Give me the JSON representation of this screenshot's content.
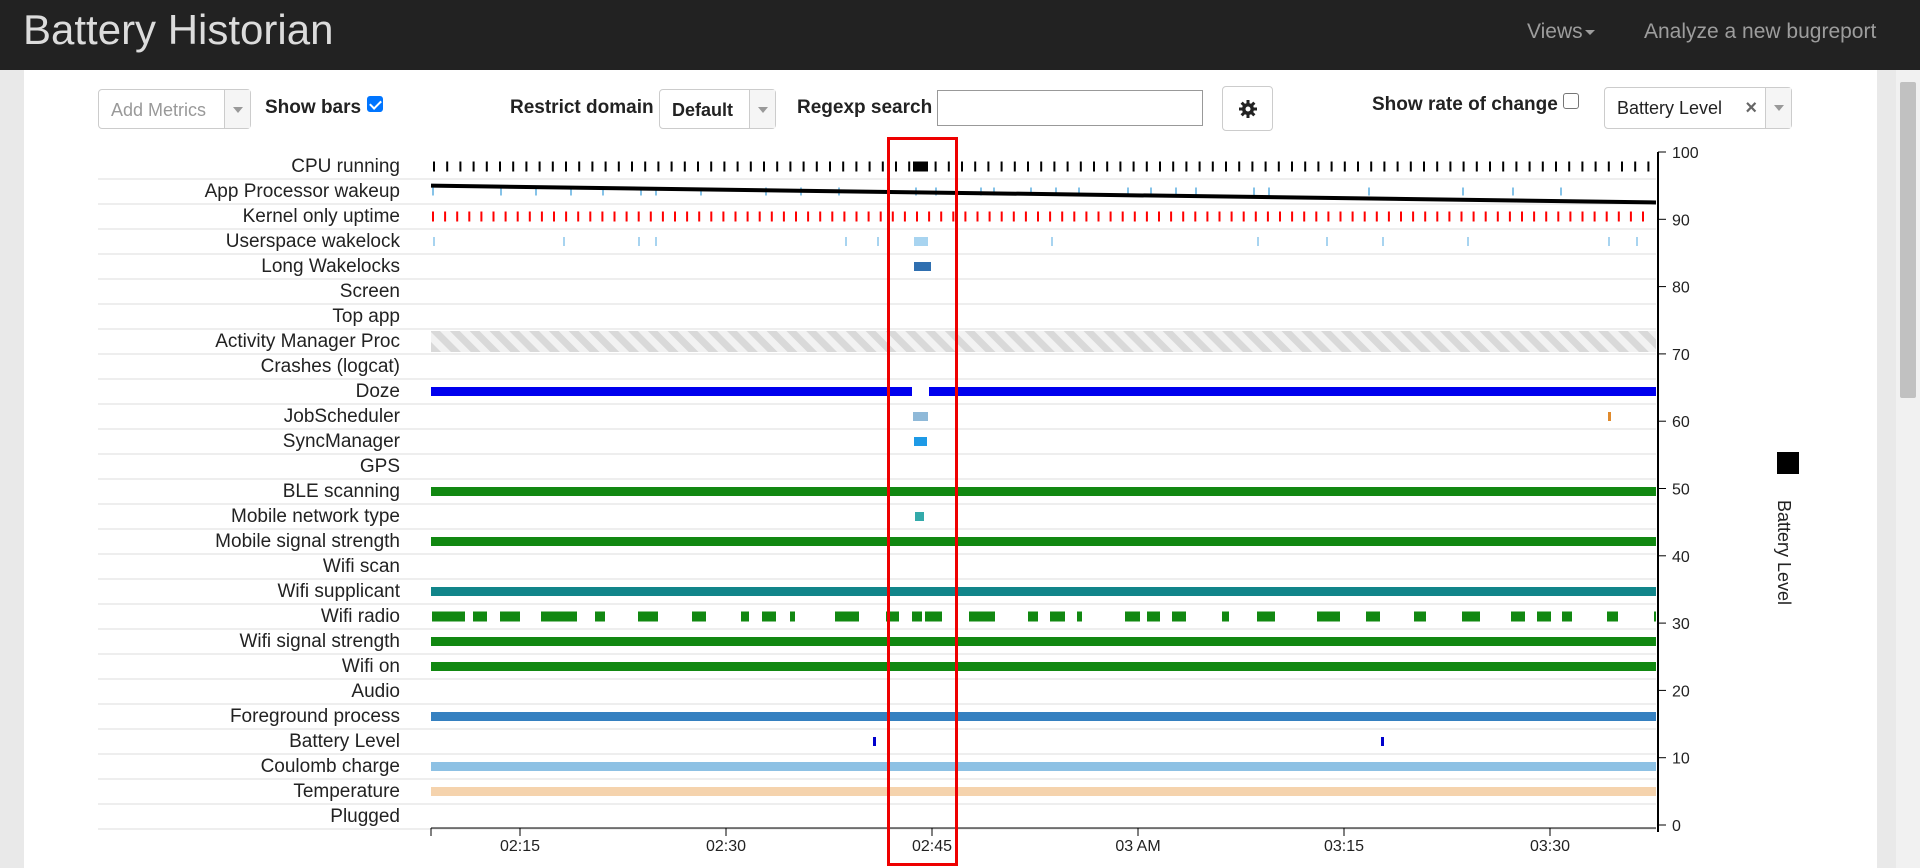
{
  "navbar": {
    "brand": "Battery Historian",
    "views_label": "Views",
    "analyze_label": "Analyze a new bugreport"
  },
  "toolbar": {
    "add_metrics_placeholder": "Add Metrics",
    "show_bars_label": "Show bars",
    "show_bars_checked": true,
    "restrict_domain_label": "Restrict domain",
    "restrict_domain_value": "Default",
    "regexp_search_label": "Regexp search",
    "regexp_search_value": "",
    "show_rate_label": "Show rate of change",
    "show_rate_checked": false,
    "metric_tag": "Battery Level",
    "settings_icon": "gear-icon"
  },
  "chart_data": {
    "type": "timeline",
    "lanes": [
      "CPU running",
      "App Processor wakeup",
      "Kernel only uptime",
      "Userspace wakelock",
      "Long Wakelocks",
      "Screen",
      "Top app",
      "Activity Manager Proc",
      "Crashes (logcat)",
      "Doze",
      "JobScheduler",
      "SyncManager",
      "GPS",
      "BLE scanning",
      "Mobile network type",
      "Mobile signal strength",
      "Wifi scan",
      "Wifi supplicant",
      "Wifi radio",
      "Wifi signal strength",
      "Wifi on",
      "Audio",
      "Foreground process",
      "Battery Level",
      "Coulomb charge",
      "Temperature",
      "Plugged"
    ],
    "x_ticks": [
      "02:15",
      "02:30",
      "02:45",
      "03 AM",
      "03:15",
      "03:30"
    ],
    "y_ticks": [
      0,
      10,
      20,
      30,
      40,
      50,
      60,
      70,
      80,
      90,
      100
    ],
    "ylim": [
      0,
      100
    ],
    "ylabel": "Battery Level",
    "battery_level_series": {
      "start": 95,
      "end": 92.5
    },
    "colors": {
      "cpu": "#000000",
      "wakeup": "#86c3e8",
      "kernel": "#ff0000",
      "userspace": "#a8d4f0",
      "long_wakelock": "#2f6fb0",
      "activity_hatch": "#d9d9d9",
      "doze": "#0000ee",
      "jobscheduler": "#8fb9d8",
      "syncmanager": "#1e9ae6",
      "green": "#118811",
      "mobile_network": "#33aaaa",
      "wifi_supplicant": "#11858a",
      "foreground": "#3580c0",
      "battery_level": "#0000cc",
      "coulomb": "#8dc1e4",
      "temperature": "#f5d3ad",
      "highlight": "#e00000"
    }
  }
}
